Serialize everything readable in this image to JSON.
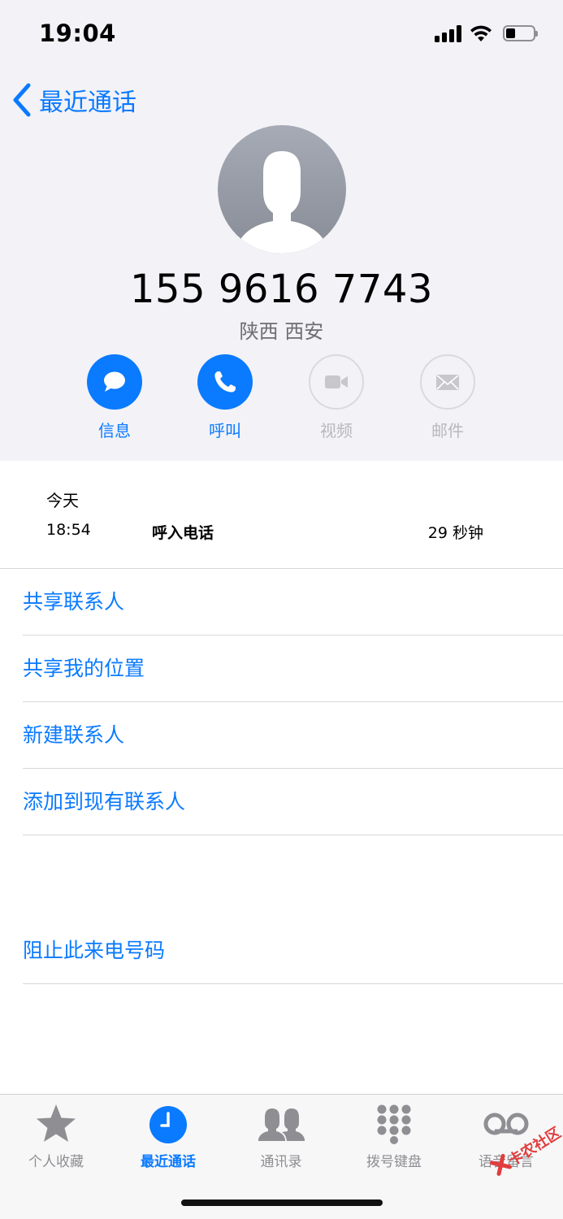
{
  "status_bar": {
    "time": "19:04"
  },
  "nav": {
    "back_label": "最近通话"
  },
  "contact": {
    "number": "155 9616 7743",
    "location": "陕西 西安"
  },
  "actions": [
    {
      "label": "信息",
      "icon": "message-icon",
      "enabled": true
    },
    {
      "label": "呼叫",
      "icon": "phone-icon",
      "enabled": true
    },
    {
      "label": "视频",
      "icon": "video-icon",
      "enabled": false
    },
    {
      "label": "邮件",
      "icon": "mail-icon",
      "enabled": false
    }
  ],
  "call_log": {
    "day": "今天",
    "entries": [
      {
        "time": "18:54",
        "type": "呼入电话",
        "duration": "29 秒钟"
      }
    ]
  },
  "menu": {
    "share_contact": "共享联系人",
    "share_location": "共享我的位置",
    "new_contact": "新建联系人",
    "add_existing": "添加到现有联系人",
    "block": "阻止此来电号码"
  },
  "tabbar": {
    "tabs": [
      {
        "label": "个人收藏",
        "icon": "star-icon",
        "active": false
      },
      {
        "label": "最近通话",
        "icon": "clock-icon",
        "active": true
      },
      {
        "label": "通讯录",
        "icon": "contacts-icon",
        "active": false
      },
      {
        "label": "拨号键盘",
        "icon": "keypad-icon",
        "active": false
      },
      {
        "label": "语音留言",
        "icon": "voicemail-icon",
        "active": false
      }
    ]
  },
  "watermark": {
    "text": "卡农社区"
  },
  "colors": {
    "accent": "#0a7aff",
    "disabled": "#b8b8bd",
    "background": "#f2f2f7"
  }
}
